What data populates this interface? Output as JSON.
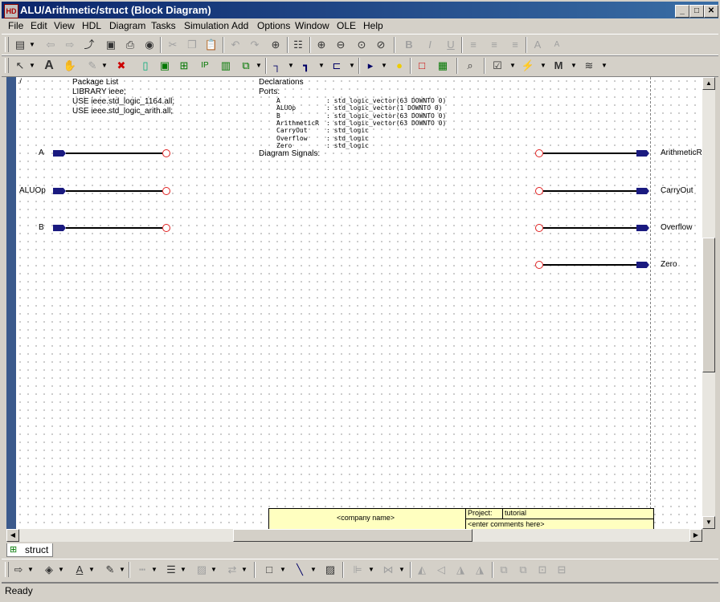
{
  "window": {
    "title": "ALU/Arithmetic/struct (Block Diagram)",
    "app_icon": "HD",
    "minimize": "_",
    "maximize": "□",
    "close": "✕"
  },
  "menu": [
    "File",
    "Edit",
    "View",
    "HDL",
    "Diagram",
    "Tasks",
    "Simulation",
    "Add",
    "Options",
    "Window",
    "OLE",
    "Help"
  ],
  "diagram": {
    "package_list": {
      "heading": "Package List",
      "lines": [
        "LIBRARY ieee;",
        "USE ieee.std_logic_1164.all;",
        "USE ieee.std_logic_arith.all;"
      ]
    },
    "declarations": {
      "heading": "Declarations",
      "ports_label": "Ports:",
      "ports": [
        {
          "name": "A",
          "type": ": std_logic_vector(63 DOWNTO 0)"
        },
        {
          "name": "ALUOp",
          "type": ": std_logic_vector(1 DOWNTO 0)"
        },
        {
          "name": "B",
          "type": ": std_logic_vector(63 DOWNTO 0)"
        },
        {
          "name": "ArithmeticR",
          "type": ": std_logic_vector(63 DOWNTO 0)"
        },
        {
          "name": "CarryOut",
          "type": ": std_logic"
        },
        {
          "name": "Overflow",
          "type": ": std_logic"
        },
        {
          "name": "Zero",
          "type": ": std_logic"
        }
      ],
      "signals_label": "Diagram Signals:"
    },
    "inputs": [
      "A",
      "ALUOp",
      "B"
    ],
    "outputs": [
      "ArithmeticR",
      "CarryOut",
      "Overflow",
      "Zero"
    ],
    "title_block": {
      "company": "<company name>",
      "project_label": "Project:",
      "project_value": "tutorial",
      "comments": "<enter comments here>"
    }
  },
  "tabs": [
    {
      "label": "struct",
      "icon": "diagram-icon"
    }
  ],
  "status": "Ready"
}
